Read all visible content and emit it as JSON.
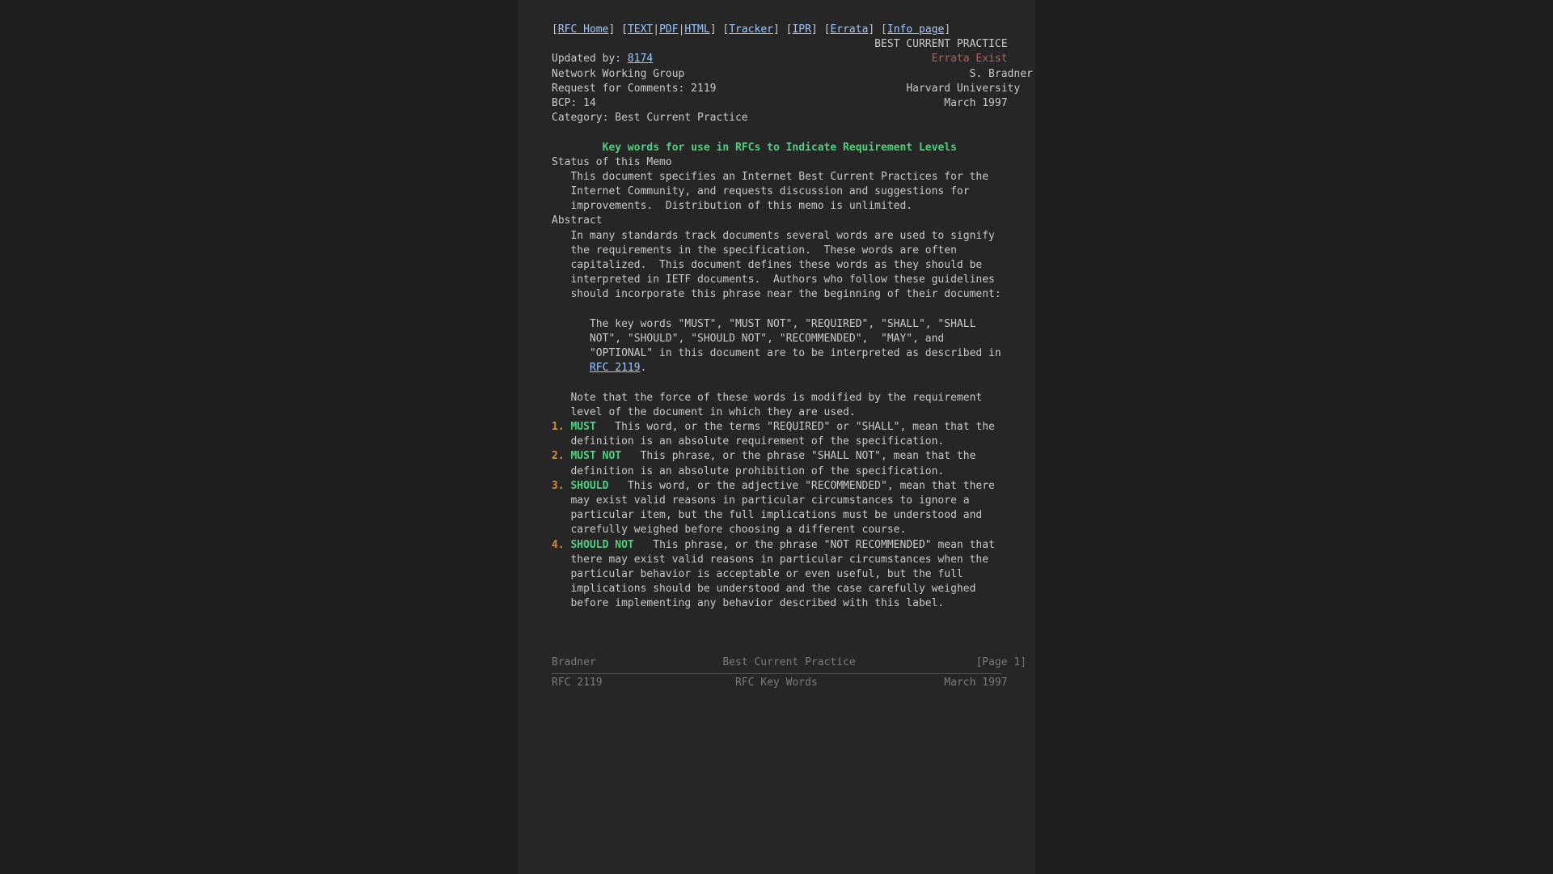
{
  "nav": {
    "rfc_home": "RFC Home",
    "text": "TEXT",
    "pdf": "PDF",
    "html": "HTML",
    "tracker": "Tracker",
    "ipr": "IPR",
    "errata": "Errata",
    "info_page": "Info page"
  },
  "header": {
    "practice_right": "BEST CURRENT PRACTICE",
    "updated_by_label": "Updated by:",
    "updated_by_rfc": "8174",
    "errata_exist": "Errata Exist",
    "nwg": "Network Working Group",
    "author": "S. Bradner",
    "rfc_line": "Request for Comments: 2119",
    "org": "Harvard University",
    "bcp_line": "BCP: 14",
    "date": "March 1997",
    "category_line": "Category: Best Current Practice"
  },
  "title": "Key words for use in RFCs to Indicate Requirement Levels",
  "status": {
    "heading": "Status of this Memo",
    "l1": "This document specifies an Internet Best Current Practices for the",
    "l2": "Internet Community, and requests discussion and suggestions for",
    "l3": "improvements.  Distribution of this memo is unlimited."
  },
  "abstract": {
    "heading": "Abstract",
    "l1": "In many standards track documents several words are used to signify",
    "l2": "the requirements in the specification.  These words are often",
    "l3": "capitalized.  This document defines these words as they should be",
    "l4": "interpreted in IETF documents.  Authors who follow these guidelines",
    "l5": "should incorporate this phrase near the beginning of their document:",
    "kw1": "The key words \"MUST\", \"MUST NOT\", \"REQUIRED\", \"SHALL\", \"SHALL",
    "kw2": "NOT\", \"SHOULD\", \"SHOULD NOT\", \"RECOMMENDED\",  \"MAY\", and",
    "kw3": "\"OPTIONAL\" in this document are to be interpreted as described in",
    "kw_ref": "RFC 2119",
    "kw_period": ".",
    "note1": "Note that the force of these words is modified by the requirement",
    "note2": "level of the document in which they are used."
  },
  "sec": [
    {
      "num": "1.",
      "kw": "MUST",
      "l1": "This word, or the terms \"REQUIRED\" or \"SHALL\", mean that the",
      "l2": "definition is an absolute requirement of the specification."
    },
    {
      "num": "2.",
      "kw": "MUST NOT",
      "l1": "This phrase, or the phrase \"SHALL NOT\", mean that the",
      "l2": "definition is an absolute prohibition of the specification."
    },
    {
      "num": "3.",
      "kw": "SHOULD",
      "l1": "This word, or the adjective \"RECOMMENDED\", mean that there",
      "l2": "may exist valid reasons in particular circumstances to ignore a",
      "l3": "particular item, but the full implications must be understood and",
      "l4": "carefully weighed before choosing a different course."
    },
    {
      "num": "4.",
      "kw": "SHOULD NOT",
      "l1": "This phrase, or the phrase \"NOT RECOMMENDED\" mean that",
      "l2": "there may exist valid reasons in particular circumstances when the",
      "l3": "particular behavior is acceptable or even useful, but the full",
      "l4": "implications should be understood and the case carefully weighed",
      "l5": "before implementing any behavior described with this label."
    }
  ],
  "pagefoot": {
    "left": "Bradner",
    "center": "Best Current Practice",
    "right": "[Page 1]"
  },
  "pagehead": {
    "left": "RFC 2119",
    "center": "RFC Key Words",
    "right": "March 1997"
  }
}
